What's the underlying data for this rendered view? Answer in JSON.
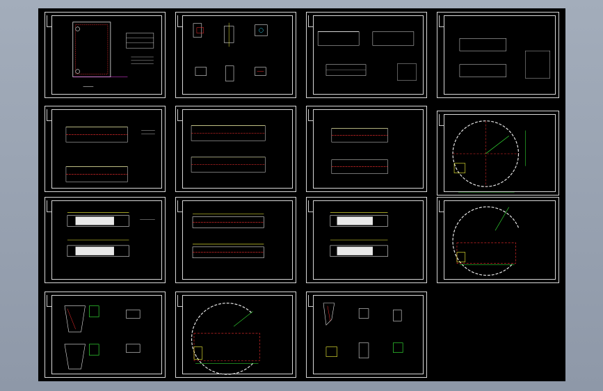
{
  "viewer": {
    "background": "#96a0b0",
    "canvas_color": "#000000",
    "sheet_border_color": "#d8d8d8",
    "accent_colors": {
      "red": "#ff3030",
      "yellow": "#ffff3a",
      "cyan": "#34e0ff",
      "green": "#3cff3c",
      "magenta": "#ff44ff",
      "white": "#e8e8e8"
    }
  },
  "sheets": [
    {
      "id": "s01",
      "kind": "cover-plan"
    },
    {
      "id": "s02",
      "kind": "node-details"
    },
    {
      "id": "s03",
      "kind": "truss-elevations"
    },
    {
      "id": "s04",
      "kind": "truss-elevations-2"
    },
    {
      "id": "s05",
      "kind": "plan-with-columns"
    },
    {
      "id": "s06",
      "kind": "plan-with-columns"
    },
    {
      "id": "s07",
      "kind": "plan-with-columns"
    },
    {
      "id": "s08",
      "kind": "circular-plan"
    },
    {
      "id": "s09",
      "kind": "beam-plan"
    },
    {
      "id": "s10",
      "kind": "beam-plan-hatched"
    },
    {
      "id": "s11",
      "kind": "beam-plan"
    },
    {
      "id": "s12",
      "kind": "circular-plan-2"
    },
    {
      "id": "s13",
      "kind": "section-details"
    },
    {
      "id": "s14",
      "kind": "circular-plan-3"
    },
    {
      "id": "s15",
      "kind": "joint-details"
    }
  ]
}
